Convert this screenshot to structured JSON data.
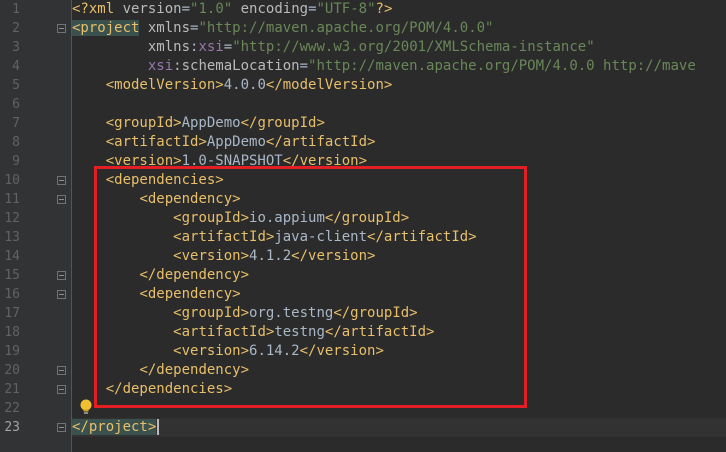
{
  "editor": {
    "lines": [
      {
        "num": "1",
        "segments": [
          {
            "t": "<?",
            "c": "pi"
          },
          {
            "t": "xml ",
            "c": "pi"
          },
          {
            "t": "version",
            "c": "attr"
          },
          {
            "t": "=",
            "c": "txt"
          },
          {
            "t": "\"1.0\"",
            "c": "str"
          },
          {
            "t": " ",
            "c": "txt"
          },
          {
            "t": "encoding",
            "c": "attr"
          },
          {
            "t": "=",
            "c": "txt"
          },
          {
            "t": "\"UTF-8\"",
            "c": "str"
          },
          {
            "t": "?>",
            "c": "pi"
          }
        ]
      },
      {
        "num": "2",
        "segments": [
          {
            "t": "<project",
            "c": "hl-tag"
          },
          {
            "t": " ",
            "c": "txt"
          },
          {
            "t": "xmlns",
            "c": "attr"
          },
          {
            "t": "=",
            "c": "txt"
          },
          {
            "t": "\"http://maven.apache.org/POM/4.0.0\"",
            "c": "str"
          }
        ]
      },
      {
        "num": "3",
        "segments": [
          {
            "t": "         ",
            "c": "txt"
          },
          {
            "t": "xmlns",
            "c": "attr"
          },
          {
            "t": ":",
            "c": "txt"
          },
          {
            "t": "xsi",
            "c": "ns"
          },
          {
            "t": "=",
            "c": "txt"
          },
          {
            "t": "\"http://www.w3.org/2001/XMLSchema-instance\"",
            "c": "str"
          }
        ]
      },
      {
        "num": "4",
        "segments": [
          {
            "t": "         ",
            "c": "txt"
          },
          {
            "t": "xsi",
            "c": "ns"
          },
          {
            "t": ":schemaLocation",
            "c": "attr"
          },
          {
            "t": "=",
            "c": "txt"
          },
          {
            "t": "\"http://maven.apache.org/POM/4.0.0 http://mave",
            "c": "str"
          }
        ]
      },
      {
        "num": "5",
        "segments": [
          {
            "t": "    ",
            "c": "txt"
          },
          {
            "t": "<modelVersion>",
            "c": "tag"
          },
          {
            "t": "4.0.0",
            "c": "txt"
          },
          {
            "t": "</modelVersion>",
            "c": "tag"
          }
        ]
      },
      {
        "num": "6",
        "segments": []
      },
      {
        "num": "7",
        "segments": [
          {
            "t": "    ",
            "c": "txt"
          },
          {
            "t": "<groupId>",
            "c": "tag"
          },
          {
            "t": "AppDemo",
            "c": "txt"
          },
          {
            "t": "</groupId>",
            "c": "tag"
          }
        ]
      },
      {
        "num": "8",
        "segments": [
          {
            "t": "    ",
            "c": "txt"
          },
          {
            "t": "<artifactId>",
            "c": "tag"
          },
          {
            "t": "AppDemo",
            "c": "txt"
          },
          {
            "t": "</artifactId>",
            "c": "tag"
          }
        ]
      },
      {
        "num": "9",
        "segments": [
          {
            "t": "    ",
            "c": "txt"
          },
          {
            "t": "<version>",
            "c": "tag"
          },
          {
            "t": "1.0-SNAPSHOT",
            "c": "txt"
          },
          {
            "t": "</version>",
            "c": "tag"
          }
        ]
      },
      {
        "num": "10",
        "segments": [
          {
            "t": "    ",
            "c": "txt"
          },
          {
            "t": "<dependencies>",
            "c": "tag"
          }
        ]
      },
      {
        "num": "11",
        "segments": [
          {
            "t": "        ",
            "c": "txt"
          },
          {
            "t": "<dependency>",
            "c": "tag"
          }
        ]
      },
      {
        "num": "12",
        "segments": [
          {
            "t": "            ",
            "c": "txt"
          },
          {
            "t": "<groupId>",
            "c": "tag"
          },
          {
            "t": "io.appium",
            "c": "txt"
          },
          {
            "t": "</groupId>",
            "c": "tag"
          }
        ]
      },
      {
        "num": "13",
        "segments": [
          {
            "t": "            ",
            "c": "txt"
          },
          {
            "t": "<artifactId>",
            "c": "tag"
          },
          {
            "t": "java-client",
            "c": "txt"
          },
          {
            "t": "</artifactId>",
            "c": "tag"
          }
        ]
      },
      {
        "num": "14",
        "segments": [
          {
            "t": "            ",
            "c": "txt"
          },
          {
            "t": "<version>",
            "c": "tag"
          },
          {
            "t": "4.1.2",
            "c": "txt"
          },
          {
            "t": "</version>",
            "c": "tag"
          }
        ]
      },
      {
        "num": "15",
        "segments": [
          {
            "t": "        ",
            "c": "txt"
          },
          {
            "t": "</dependency>",
            "c": "tag"
          }
        ]
      },
      {
        "num": "16",
        "segments": [
          {
            "t": "        ",
            "c": "txt"
          },
          {
            "t": "<dependency>",
            "c": "tag"
          }
        ]
      },
      {
        "num": "17",
        "segments": [
          {
            "t": "            ",
            "c": "txt"
          },
          {
            "t": "<groupId>",
            "c": "tag"
          },
          {
            "t": "org.testng",
            "c": "txt"
          },
          {
            "t": "</groupId>",
            "c": "tag"
          }
        ]
      },
      {
        "num": "18",
        "segments": [
          {
            "t": "            ",
            "c": "txt"
          },
          {
            "t": "<artifactId>",
            "c": "tag"
          },
          {
            "t": "testng",
            "c": "txt"
          },
          {
            "t": "</artifactId>",
            "c": "tag"
          }
        ]
      },
      {
        "num": "19",
        "segments": [
          {
            "t": "            ",
            "c": "txt"
          },
          {
            "t": "<version>",
            "c": "tag"
          },
          {
            "t": "6.14.2",
            "c": "txt"
          },
          {
            "t": "</version>",
            "c": "tag"
          }
        ]
      },
      {
        "num": "20",
        "segments": [
          {
            "t": "        ",
            "c": "txt"
          },
          {
            "t": "</dependency>",
            "c": "tag"
          }
        ]
      },
      {
        "num": "21",
        "segments": [
          {
            "t": "    ",
            "c": "txt"
          },
          {
            "t": "</dependencies>",
            "c": "tag"
          }
        ]
      },
      {
        "num": "22",
        "segments": []
      },
      {
        "num": "23",
        "segments": [
          {
            "t": "</project>",
            "c": "hl-tag"
          }
        ]
      }
    ],
    "current_line": "23",
    "colors": {
      "background": "#2b2b2b",
      "gutter": "#313335",
      "tag": "#e8bf6a",
      "attribute": "#bababa",
      "namespace": "#9876aa",
      "string": "#6a8759",
      "text": "#a9b7c6",
      "highlight_box": "#e31e24"
    },
    "icons": {
      "intention_bulb": "lightbulb-icon",
      "fold_marker": "fold-toggle-icon"
    }
  }
}
